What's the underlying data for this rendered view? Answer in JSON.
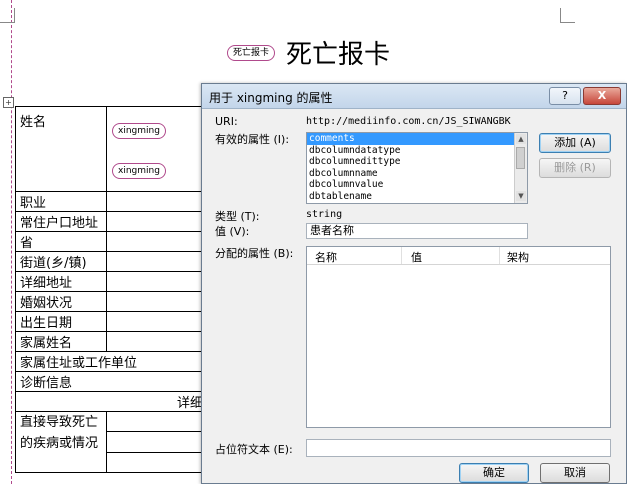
{
  "document": {
    "title": "死亡报卡",
    "title_tag": "死亡报卡",
    "name_tags": [
      "xingming",
      "xingming"
    ],
    "name_label": "姓名",
    "rows": [
      "职业",
      "常住户口地址",
      "省",
      "街道(乡/镇)",
      "详细地址",
      "婚姻状况",
      "出生日期",
      "家属姓名",
      "家属住址或工作单位",
      "诊断信息"
    ],
    "detail_header": "详细",
    "cause_label": "直接导致死亡的疾病或情况"
  },
  "dialog": {
    "title": "用于 xingming 的属性",
    "help_button": "?",
    "close_button": "X",
    "uri_label": "URI:",
    "uri_value": "http://mediinfo.com.cn/JS_SIWANGBK",
    "valid_attrs_label": "有效的属性 (I):",
    "valid_attrs": [
      "comments",
      "dbcolumndatatype",
      "dbcolumnedittype",
      "dbcolumnname",
      "dbcolumnvalue",
      "dbtablename"
    ],
    "selected_index": 0,
    "add_button": "添加 (A)",
    "delete_button": "删除 (R)",
    "type_label": "类型 (T):",
    "type_value": "string",
    "value_label": "值 (V):",
    "value_value": "患者名称",
    "assigned_label": "分配的属性 (B):",
    "assigned_columns": [
      "名称",
      "值",
      "架构"
    ],
    "placeholder_label": "占位符文本 (E):",
    "placeholder_value": "",
    "ok_button": "确定",
    "cancel_button": "取消"
  }
}
